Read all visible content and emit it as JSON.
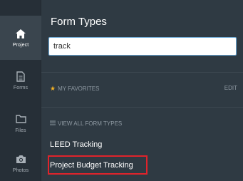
{
  "sidebar": {
    "items": [
      {
        "label": "Project",
        "icon": "home-icon",
        "active": true
      },
      {
        "label": "Forms",
        "icon": "document-icon",
        "active": false
      },
      {
        "label": "Files",
        "icon": "folder-icon",
        "active": false
      },
      {
        "label": "Photos",
        "icon": "camera-icon",
        "active": false
      }
    ]
  },
  "main": {
    "title": "Form Types",
    "search": {
      "value": "track",
      "placeholder": ""
    },
    "favorites": {
      "label": "MY FAVORITES",
      "edit_label": "EDIT"
    },
    "all_types": {
      "label": "VIEW ALL FORM TYPES"
    },
    "results": [
      "LEED Tracking",
      "Project Budget Tracking"
    ]
  },
  "colors": {
    "sidebar_bg": "#262f37",
    "panel_bg": "#2f3a43",
    "favorite_star": "#f5b223",
    "highlight_border": "#e0232b",
    "search_border": "#6aa9d7"
  }
}
